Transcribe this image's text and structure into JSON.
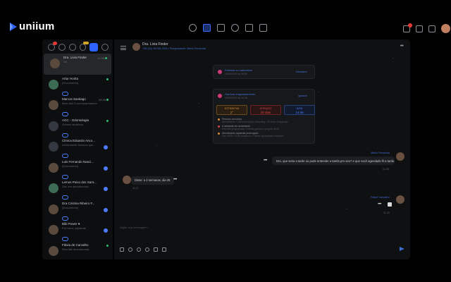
{
  "app": {
    "logo_text": "uniium"
  },
  "colors": {
    "accent": "#2e63ff",
    "link": "#3f6ed6",
    "unread_badge": "#e53935",
    "online": "#2fbf71"
  },
  "topnav": {
    "center_icons": [
      "clock-icon",
      "chat-icon",
      "briefcase-icon",
      "contacts-icon",
      "chart-icon",
      "calendar-icon"
    ],
    "active_icon": "chat-icon",
    "right_icons": [
      "bell-icon",
      "tasks-icon",
      "apps-icon"
    ],
    "user_avatar": "user-avatar"
  },
  "sidebar": {
    "tabs": [
      "inbox-icon",
      "chat-icon",
      "check-icon",
      "star-icon",
      "active-icon",
      "filter-icon"
    ],
    "conversations": [
      {
        "name": "Dra. Livia Finder",
        "time": "11:25",
        "preview": "Ok",
        "selected": true
      },
      {
        "name": "Artur Horita",
        "time": "",
        "preview": "(Documento)",
        "tag": ""
      },
      {
        "name": "Marcos Santiago",
        "time": "09:48",
        "preview": "Bom dia! O acompanhamento...",
        "tag": ""
      },
      {
        "name": "AGC - Odontologia",
        "time": "",
        "preview": "Grêmio atualizou",
        "tag": ""
      },
      {
        "name": "Clínica Eduardo Anco...",
        "time": "",
        "preview": "Infelizmente tivemos que...",
        "tag": ""
      },
      {
        "name": "Luis Fernando Nasci...",
        "time": "",
        "preview": "(Documento)",
        "tag": ""
      },
      {
        "name": "Lemos Peixo dos Sant...",
        "time": "",
        "preview": "Olá, em atendimento!",
        "tag": ""
      },
      {
        "name": "Dra Cristina Ribeiro F...",
        "time": "",
        "preview": "(Documento)",
        "tag": ""
      },
      {
        "name": "Bibi Power ♥",
        "time": "",
        "preview": "Por favor, aguardar",
        "tag": ""
      },
      {
        "name": "Flávia de Carvalho",
        "time": "",
        "preview": "Reunião desmarcada...",
        "tag": ""
      }
    ]
  },
  "chat": {
    "contact_name": "Dra. Livia Finder",
    "contact_phone": "+55 (21) 98765-1300 • Responsável: Maria Fernanda",
    "event1": {
      "title": "Entrada no calendário",
      "sub": "15/05/2023 às 09:30",
      "action": "Desfazer"
    },
    "event2": {
      "title": "Ganhou enquadramento",
      "sub": "15/05/2023 às 14:46",
      "action": "Ignorar",
      "stats": [
        {
          "label": "ESTIMATIVA",
          "value": "2°"
        },
        {
          "label": "ATENÇÃO",
          "value": "25 dias"
        },
        {
          "label": "DATA",
          "value": "14:46"
        }
      ],
      "lines": [
        {
          "text": "Resumo concluído",
          "sub": "Atendimento • 2023 em Ações Marketing • 05 total • Arquivado"
        },
        {
          "text": "A atividade em andamento",
          "sub": "Reunião programada • Cliente ganhou o projeto de 4h"
        },
        {
          "text": "Atendimento aguardar prolongado",
          "sub": "Dia 15/05 • 14:46 atualizou • Cliente aguardando resposta"
        }
      ]
    },
    "outgoing1": {
      "sender": "Maria Fernanda",
      "text": "Dra, que seria a tarde ou pude entender a tarefa pro seu? e que você agendado fil a tarde.",
      "time": "11:28"
    },
    "incoming": {
      "text": "Disse: a 2 semanas, dia 25",
      "time": "11:27"
    },
    "outgoing2": {
      "sender": "Felipe Carvalho",
      "time": "11:29"
    },
    "composer_placeholder": "Digite sua mensagem...",
    "composer_icons": [
      "emoji-icon",
      "attach-icon",
      "location-icon",
      "mention-icon",
      "mail-icon",
      "video-icon"
    ]
  }
}
